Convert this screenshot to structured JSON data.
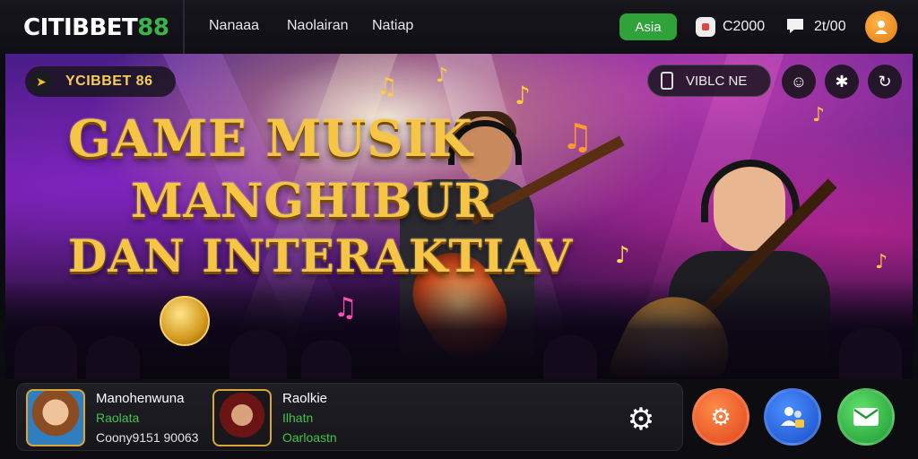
{
  "header": {
    "logo_part1": "CITIBBET",
    "logo_part2": "88",
    "nav": [
      "Nanaaa",
      "Naolairan",
      "Natiap"
    ],
    "region_button": "Asia",
    "coin_balance": "C2000",
    "chat_count": "2t/00",
    "accent_green": "#2fa23a"
  },
  "hero": {
    "brand_badge": "YCIBBET 86",
    "video_label": "VIBLC NE",
    "title_lines": [
      "GAME MUSIK",
      "MANGHIBUR",
      "DAN INTERAKTIAV"
    ],
    "title_color": "#f6c545",
    "icons": [
      "smile-icon",
      "star-icon",
      "refresh-icon"
    ]
  },
  "players": [
    {
      "name": "Manohenwuna",
      "status": "Raolata",
      "meta": "Coony9151 90063"
    },
    {
      "name": "Raolkie",
      "status": "Ilhatn",
      "meta": "Oarloastn"
    }
  ],
  "actions": [
    {
      "icon": "settings-icon",
      "color": "#e0441a"
    },
    {
      "icon": "users-icon",
      "color": "#1a4ec8"
    },
    {
      "icon": "message-icon",
      "color": "#1e9a34"
    }
  ]
}
